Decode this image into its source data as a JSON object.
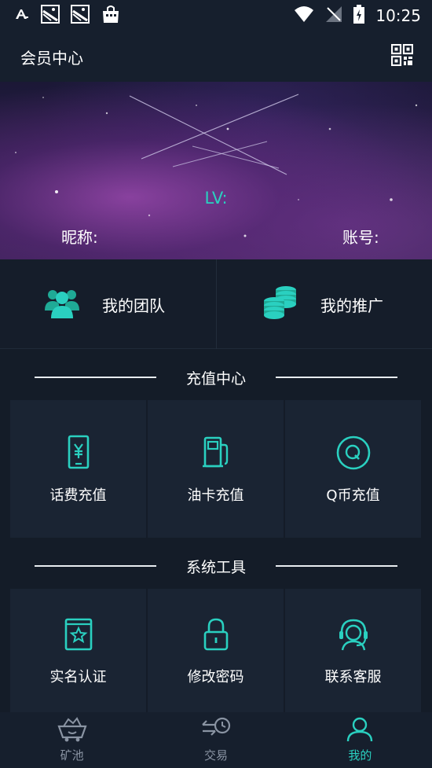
{
  "status_bar": {
    "time": "10:25",
    "left_icons": [
      "font-a-icon",
      "image-notification-icon",
      "image-notification-icon",
      "shopping-bag-icon"
    ],
    "right_icons": [
      "wifi-icon",
      "no-signal-icon",
      "battery-charging-icon"
    ]
  },
  "header": {
    "title": "会员中心",
    "action_icon": "qr-code-icon"
  },
  "banner": {
    "lv_label": "LV:",
    "nickname_label": "昵称:",
    "account_label": "账号:"
  },
  "quick_links": [
    {
      "label": "我的团队",
      "icon": "team-icon"
    },
    {
      "label": "我的推广",
      "icon": "coins-stack-icon"
    }
  ],
  "recharge_section": {
    "title": "充值中心",
    "items": [
      {
        "label": "话费充值",
        "icon": "phone-yuan-icon"
      },
      {
        "label": "油卡充值",
        "icon": "fuel-pump-icon"
      },
      {
        "label": "Q币充值",
        "icon": "q-coin-icon"
      }
    ]
  },
  "tools_section": {
    "title": "系统工具",
    "items": [
      {
        "label": "实名认证",
        "icon": "id-card-star-icon"
      },
      {
        "label": "修改密码",
        "icon": "lock-icon"
      },
      {
        "label": "联系客服",
        "icon": "customer-service-icon"
      }
    ]
  },
  "bottom_nav": [
    {
      "label": "矿池",
      "icon": "mine-cart-icon",
      "active": false
    },
    {
      "label": "交易",
      "icon": "exchange-clock-icon",
      "active": false
    },
    {
      "label": "我的",
      "icon": "person-icon",
      "active": true
    }
  ],
  "colors": {
    "background": "#141c28",
    "accent": "#2ad0c0",
    "tile": "#1a2433",
    "nav_inactive": "#8a94a3"
  }
}
